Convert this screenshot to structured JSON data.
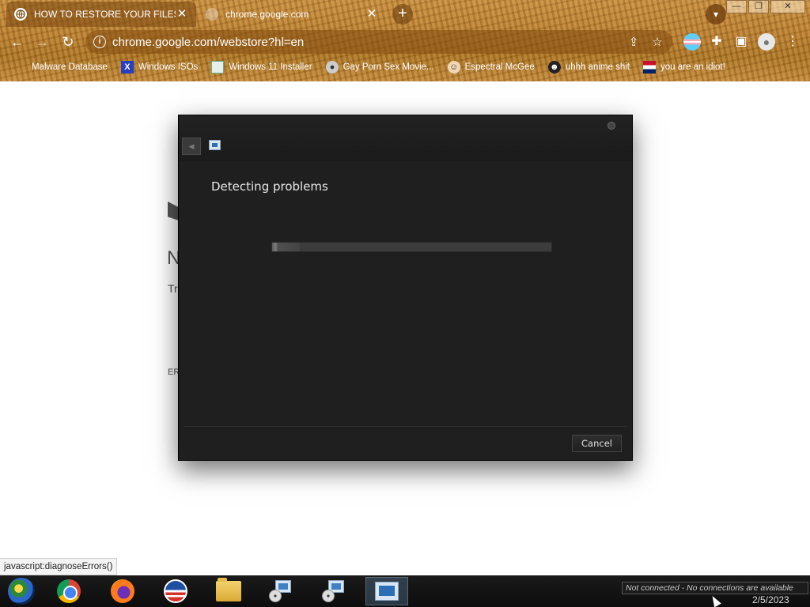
{
  "browser": {
    "tabs": [
      {
        "title": "HOW TO RESTORE YOUR FILES",
        "active": true
      },
      {
        "title": "chrome.google.com",
        "active": false
      }
    ],
    "url": "chrome.google.com/webstore?hl=en",
    "window_buttons": {
      "minimize": "—",
      "restore": "❐",
      "close": "✕"
    },
    "bookmarks": [
      {
        "label": "Malware Database",
        "icon": "malware-icon"
      },
      {
        "label": "Windows ISOs",
        "icon": "x-icon"
      },
      {
        "label": "Windows 11 Installer",
        "icon": "installer-icon"
      },
      {
        "label": "Gay Porn Sex Movie...",
        "icon": "disc-icon"
      },
      {
        "label": "Espectral McGee",
        "icon": "face-icon"
      },
      {
        "label": "uhhh anime shit",
        "icon": "anime-icon"
      },
      {
        "label": "you are an idiot!",
        "icon": "flag-icon"
      }
    ]
  },
  "page_fragments": {
    "n": "N",
    "tr": "Tr",
    "er": "ER"
  },
  "dialog": {
    "heading": "Detecting problems",
    "progress": 0.1,
    "cancel_label": "Cancel"
  },
  "status_bubble": "javascript:diagnoseErrors()",
  "taskbar": {
    "tray_message": "Not connected - No connections are available",
    "date": "2/5/2023"
  }
}
